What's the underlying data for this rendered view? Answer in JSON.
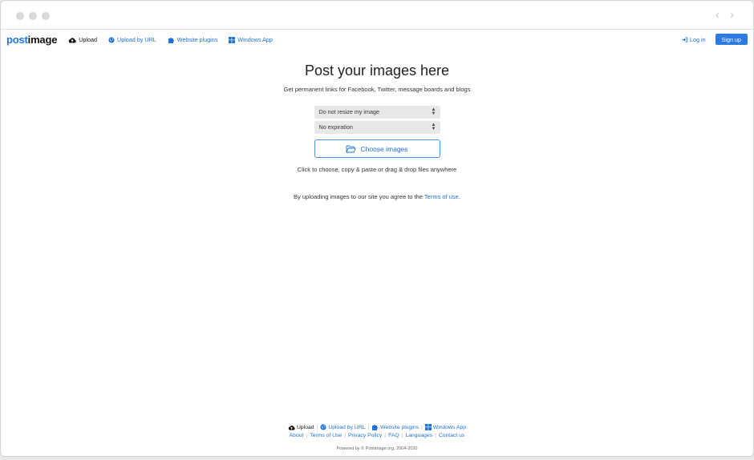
{
  "nav": {
    "logo_a": "post",
    "logo_b": "image",
    "links": [
      "Upload",
      "Upload by URL",
      "Website plugins",
      "Windows App"
    ],
    "login": "Log in",
    "signup": "Sign up"
  },
  "main": {
    "title": "Post your images here",
    "subtitle": "Get permanent links for Facebook, Twitter, message boards and blogs",
    "resize_select": "Do not resize my image",
    "expiration_select": "No expiration",
    "choose_button": "Choose images",
    "hint": "Click to choose, copy & paste or drag & drop files anywhere",
    "agree_prefix": "By uploading images to our site you agree to the ",
    "terms_link": "Terms of use",
    "agree_suffix": "."
  },
  "footer": {
    "links1": [
      "Upload",
      "Upload by URL",
      "Website plugins",
      "Windows App"
    ],
    "links2": [
      "About",
      "Terms of Use",
      "Privacy Policy",
      "FAQ",
      "Languages",
      "Contact us"
    ],
    "powered": "Powered by © Postimage.org, 2004-2020"
  },
  "colors": {
    "accent": "#1e72d9",
    "button": "#2a7ae2"
  }
}
